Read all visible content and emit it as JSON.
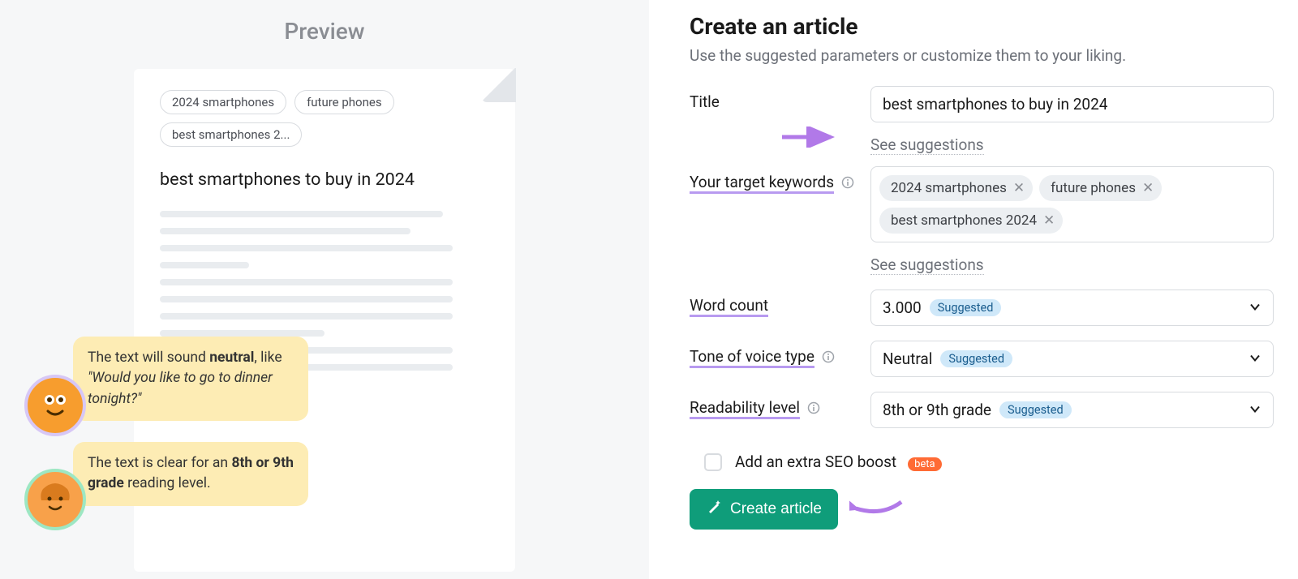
{
  "preview": {
    "heading": "Preview",
    "tags": [
      "2024 smartphones",
      "future phones",
      "best smartphones 2..."
    ],
    "doc_title": "best smartphones to buy in 2024",
    "bubble1_pre": "The text will sound ",
    "bubble1_strong": "neutral",
    "bubble1_post": ", like ",
    "bubble1_example": "\"Would you like to go to dinner tonight?\"",
    "bubble2_pre": "The text is clear for an ",
    "bubble2_strong": "8th or 9th grade",
    "bubble2_post": " reading level."
  },
  "form": {
    "heading": "Create an article",
    "subheading": "Use the suggested parameters or customize them to your liking.",
    "title_label": "Title",
    "title_value": "best smartphones to buy in 2024",
    "see_suggestions": "See suggestions",
    "keywords_label": "Your target keywords",
    "keywords": [
      "2024 smartphones",
      "future phones",
      "best smartphones 2024"
    ],
    "wordcount_label": "Word count",
    "wordcount_value": "3.000",
    "suggested_badge": "Suggested",
    "tone_label": "Tone of voice type",
    "tone_value": "Neutral",
    "read_label": "Readability level",
    "read_value": "8th or 9th grade",
    "seo_label": "Add an extra SEO boost",
    "beta_badge": "beta",
    "create_btn": "Create article"
  }
}
